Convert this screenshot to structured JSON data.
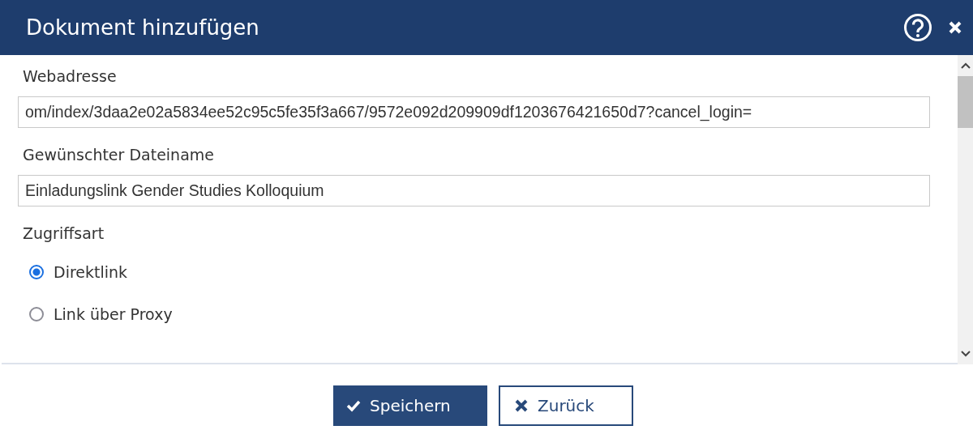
{
  "window": {
    "title": "Dokument hinzufügen"
  },
  "fields": [
    {
      "label": "Webadresse",
      "value": "om/index/3daa2e02a5834ee52c95c5fe35f3a667/9572e092d209909df1203676421650d7?cancel_login="
    },
    {
      "label": "Gewünschter Dateiname",
      "value": "Einladungslink Gender Studies Kolloquium"
    }
  ],
  "access": {
    "label": "Zugriffsart",
    "options": [
      {
        "label": "Direktlink",
        "selected": true
      },
      {
        "label": "Link über Proxy",
        "selected": false
      }
    ]
  },
  "buttons": [
    {
      "kind": "primary",
      "label": "Speichern"
    },
    {
      "kind": "secondary",
      "label": "Zurück"
    }
  ]
}
